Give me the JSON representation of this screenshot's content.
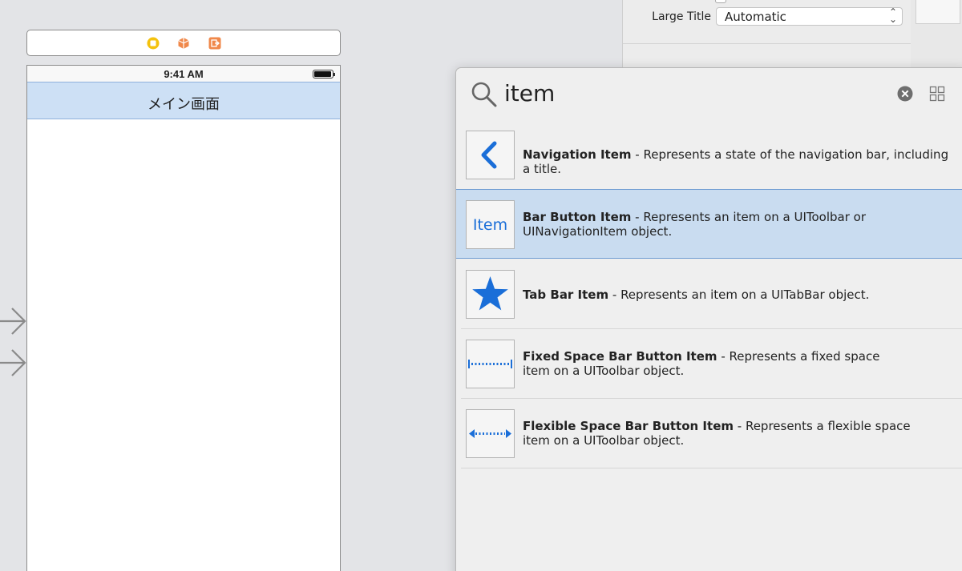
{
  "inspector": {
    "large_title_label": "Large Title",
    "large_title_value": "Automatic"
  },
  "scene": {
    "status_time": "9:41 AM",
    "nav_title": "メイン画面"
  },
  "library": {
    "search_query": "item",
    "items": [
      {
        "name": "Navigation Item",
        "separator": " - ",
        "description": "Represents a state of the navigation bar, including a title.",
        "icon": "chevron-left-icon",
        "selected": false
      },
      {
        "name": "Bar Button Item",
        "separator": " - ",
        "description": "Represents an item on a UIToolbar or UINavigationItem object.",
        "icon": "item-text-icon",
        "icon_text": "Item",
        "selected": true
      },
      {
        "name": "Tab Bar Item",
        "separator": " - ",
        "description": "Represents an item on a UITabBar object.",
        "icon": "star-icon",
        "selected": false
      },
      {
        "name": "Fixed Space Bar Button Item",
        "separator": " - ",
        "description": "Represents a fixed space item on a UIToolbar object.",
        "icon": "fixed-space-icon",
        "selected": false
      },
      {
        "name": "Flexible Space Bar Button Item",
        "separator": " - ",
        "description": "Represents a flexible space item on a UIToolbar object.",
        "icon": "flexible-space-icon",
        "selected": false
      }
    ]
  },
  "colors": {
    "accent": "#1a6ed8",
    "selection": "#c9dcf0",
    "navbar": "#cde0f5"
  }
}
